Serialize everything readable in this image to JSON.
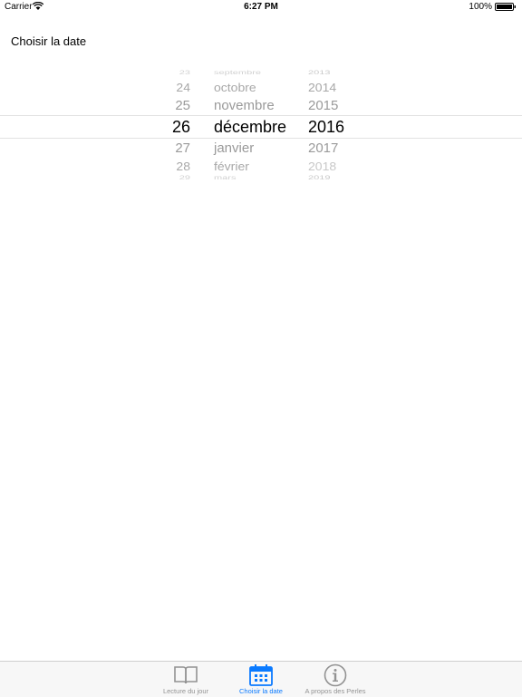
{
  "status_bar": {
    "carrier": "Carrier",
    "time": "6:27 PM",
    "battery": "100%"
  },
  "page": {
    "title": "Choisir la date"
  },
  "picker": {
    "days": [
      "23",
      "24",
      "25",
      "26",
      "27",
      "28",
      "29"
    ],
    "months": [
      "septembre",
      "octobre",
      "novembre",
      "décembre",
      "janvier",
      "février",
      "mars"
    ],
    "years": [
      "2013",
      "2014",
      "2015",
      "2016",
      "2017",
      "2018",
      "2019"
    ],
    "selected": {
      "day": "26",
      "month": "décembre",
      "year": "2016"
    }
  },
  "tabs": [
    {
      "label": "Lecture du jour",
      "icon": "book-icon",
      "active": false
    },
    {
      "label": "Choisir la date",
      "icon": "calendar-icon",
      "active": true
    },
    {
      "label": "A propos des Perles",
      "icon": "info-icon",
      "active": false
    }
  ],
  "colors": {
    "accent": "#0a7aff",
    "tab_inactive": "#929292"
  }
}
